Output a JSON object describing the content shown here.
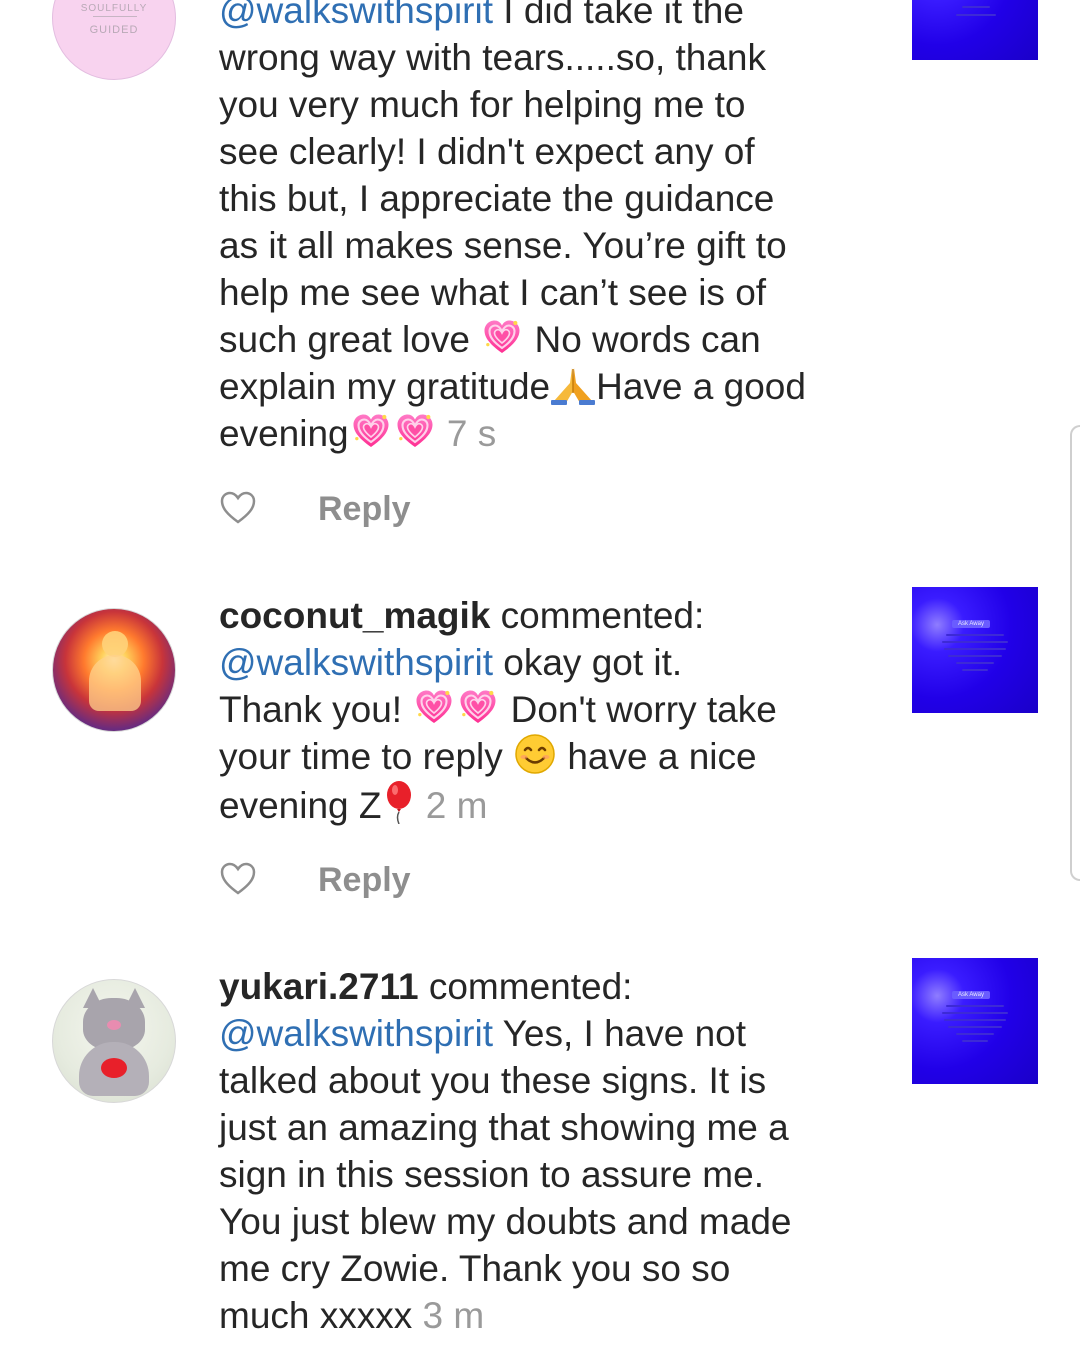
{
  "comments": [
    {
      "avatar_text_top": "SOULFULLY",
      "avatar_text_bottom": "GUIDED",
      "mention": "@walkswithspirit",
      "lines": {
        "l1": " I did take it the",
        "l2": "wrong way with tears.....so, thank",
        "l3": "you very much for helping me to",
        "l4": "see clearly! I didn't expect any of",
        "l5": "this but, I appreciate the guidance",
        "l6": "as it all makes sense. You’re gift to",
        "l7": "help me see what I can’t see is of",
        "l8a": "such great love ",
        "l8b": " No words can",
        "l9a": "explain my gratitude",
        "l9b": "Have a good",
        "l10": "evening"
      },
      "time": "7 s",
      "reply": "Reply"
    },
    {
      "username": "coconut_magik",
      "action": " commented:",
      "mention": "@walkswithspirit",
      "lines": {
        "l1": " okay got it.",
        "l2a": "Thank you! ",
        "l2b": " Don't worry take",
        "l3a": "your time to reply ",
        "l3b": " have a nice",
        "l4": "evening Z"
      },
      "time": "2 m",
      "reply": "Reply",
      "thumb_tag": "Ask Away"
    },
    {
      "username": "yukari.2711",
      "action": " commented:",
      "mention": "@walkswithspirit",
      "lines": {
        "l1": " Yes, I have not",
        "l2": "talked about you these signs. It is",
        "l3": "just an amazing that showing me a",
        "l4": "sign in this session to assure me.",
        "l5": "You just blew my doubts and made",
        "l6": "me cry Zowie. Thank you so so",
        "l7": "much xxxxx"
      },
      "time": "3 m",
      "thumb_tag": "Ask Away"
    }
  ],
  "colors": {
    "mention": "#2f6fb3",
    "timestamp": "#9a9a9a",
    "reply": "#8e8e8e",
    "thumbnail": "#2100e8"
  },
  "icons": [
    "heart-icon",
    "sparkling-heart-emoji",
    "folded-hands-emoji",
    "smiling-face-emoji",
    "balloon-emoji"
  ]
}
